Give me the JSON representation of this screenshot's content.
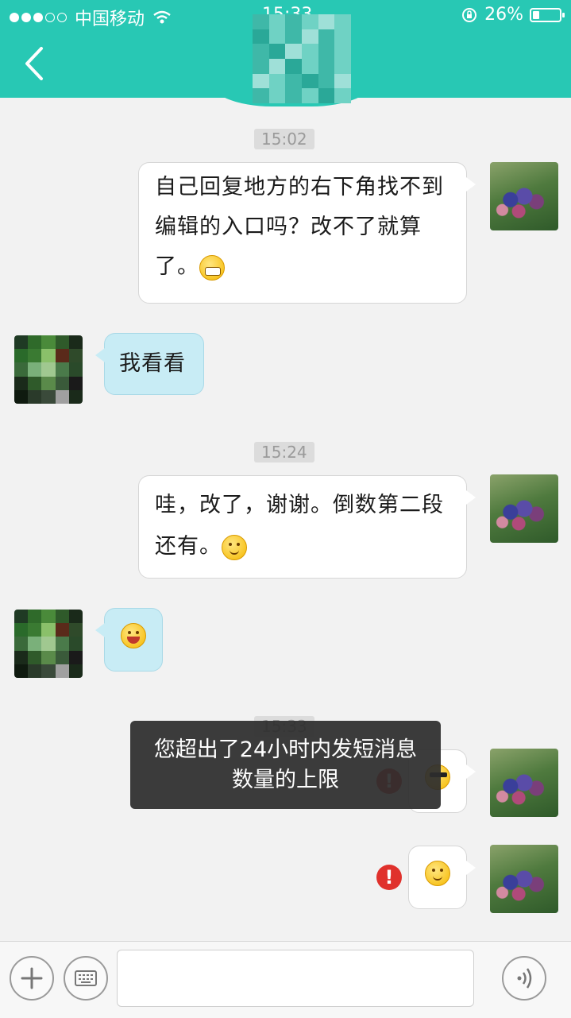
{
  "status_bar": {
    "carrier": "中国移动",
    "time": "15:33",
    "battery": "26%",
    "battery_level": 0.26
  },
  "header": {
    "back_icon": "chevron-left-icon"
  },
  "messages": [
    {
      "time": "15:02"
    },
    {
      "sender": "me",
      "text": [
        "自己回复地方的右下角找不到",
        "编辑的入口吗？改不了就算",
        "了。"
      ],
      "emoji": "grin"
    },
    {
      "sender": "other",
      "text": [
        "我看看"
      ]
    },
    {
      "time": "15:24"
    },
    {
      "sender": "me",
      "text": [
        "哇，改了，谢谢。倒数第二段",
        "还有。"
      ],
      "emoji": "smile"
    },
    {
      "sender": "other",
      "emoji": "laugh"
    },
    {
      "time": "15:33"
    },
    {
      "sender": "me",
      "emoji": "cool",
      "failed": true
    },
    {
      "sender": "me",
      "emoji": "smile",
      "failed": true
    }
  ],
  "toast": {
    "line1": "您超出了24小时内发短消息",
    "line2": "数量的上限"
  },
  "input_bar": {
    "left_buttons": [
      "plus-icon",
      "keyboard-icon"
    ],
    "right_button": "voice-icon"
  },
  "colors": {
    "header": "#28c8b4",
    "other_bubble": "#c8ecf5",
    "error": "#e0312c"
  }
}
